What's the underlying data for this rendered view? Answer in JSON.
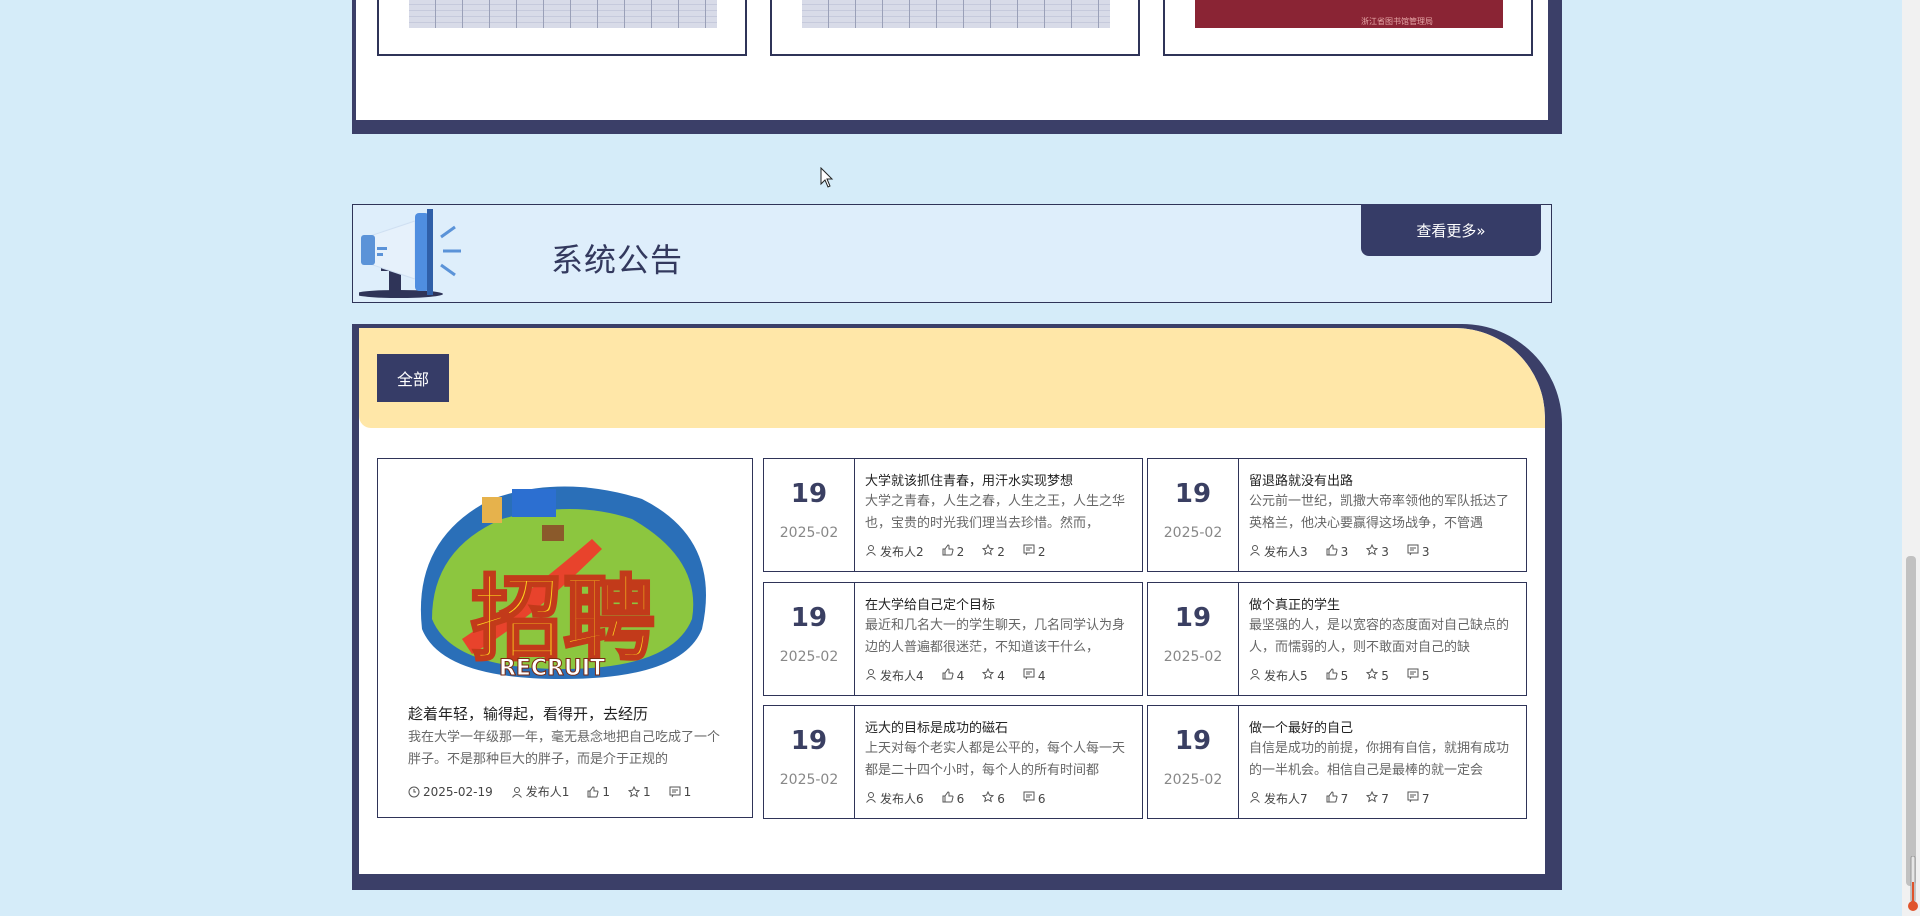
{
  "colors": {
    "background": "#d5ecf9",
    "navy": "#363c67",
    "tab_strip": "#ffe7a8",
    "banner_bg": "#deeefb"
  },
  "top_cards": [
    {
      "thumb": "document-scan"
    },
    {
      "thumb": "document-scan"
    },
    {
      "thumb": "red-certificate",
      "caption": "浙江省图书馆管理局"
    }
  ],
  "banner": {
    "icon": "megaphone-icon",
    "title": "系统公告",
    "more_label": "查看更多»"
  },
  "tabs": [
    {
      "label": "全部",
      "active": true
    }
  ],
  "featured": {
    "image": "recruit-poster",
    "image_text_main": "招聘",
    "image_text_sub": "RECRUIT",
    "title": "趁着年轻，输得起，看得开，去经历",
    "summary": "我在大学一年级那一年，毫无悬念地把自己吃成了一个胖子。不是那种巨大的胖子，而是介于正规的",
    "date": "2025-02-19",
    "author": "发布人1",
    "likes": "1",
    "favorites": "1",
    "comments": "1"
  },
  "news": [
    {
      "day": "19",
      "ym": "2025-02",
      "title": "大学就该抓住青春，用汗水实现梦想",
      "summary": "大学之青春，人生之春，人生之王，人生之华也，宝贵的时光我们理当去珍惜。然而，",
      "author": "发布人2",
      "likes": "2",
      "favorites": "2",
      "comments": "2"
    },
    {
      "day": "19",
      "ym": "2025-02",
      "title": "留退路就没有出路",
      "summary": "公元前一世纪，凯撒大帝率领他的军队抵达了英格兰，他决心要赢得这场战争，不管遇",
      "author": "发布人3",
      "likes": "3",
      "favorites": "3",
      "comments": "3"
    },
    {
      "day": "19",
      "ym": "2025-02",
      "title": "在大学给自己定个目标",
      "summary": "最近和几名大一的学生聊天，几名同学认为身边的人普遍都很迷茫，不知道该干什么，",
      "author": "发布人4",
      "likes": "4",
      "favorites": "4",
      "comments": "4"
    },
    {
      "day": "19",
      "ym": "2025-02",
      "title": "做个真正的学生",
      "summary": "最坚强的人，是以宽容的态度面对自己缺点的人，而懦弱的人，则不敢面对自己的缺",
      "author": "发布人5",
      "likes": "5",
      "favorites": "5",
      "comments": "5"
    },
    {
      "day": "19",
      "ym": "2025-02",
      "title": "远大的目标是成功的磁石",
      "summary": "上天对每个老实人都是公平的，每个人每一天都是二十四个小时，每个人的所有时间都",
      "author": "发布人6",
      "likes": "6",
      "favorites": "6",
      "comments": "6"
    },
    {
      "day": "19",
      "ym": "2025-02",
      "title": "做一个最好的自己",
      "summary": "自信是成功的前提，你拥有自信，就拥有成功的一半机会。相信自己是最棒的就一定会",
      "author": "发布人7",
      "likes": "7",
      "favorites": "7",
      "comments": "7"
    }
  ]
}
